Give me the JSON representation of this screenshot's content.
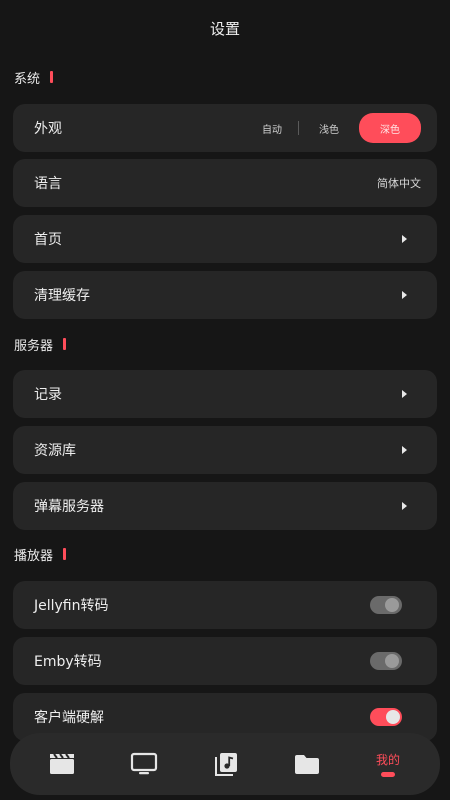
{
  "header": {
    "title": "设置"
  },
  "sections": {
    "system": {
      "title": "系统"
    },
    "server": {
      "title": "服务器"
    },
    "player": {
      "title": "播放器"
    }
  },
  "system": {
    "appearance": {
      "label": "外观",
      "options": [
        "自动",
        "浅色",
        "深色"
      ],
      "selected": "深色"
    },
    "language": {
      "label": "语言",
      "value": "简体中文"
    },
    "home": {
      "label": "首页"
    },
    "clear_cache": {
      "label": "清理缓存"
    }
  },
  "server": {
    "records": {
      "label": "记录"
    },
    "library": {
      "label": "资源库"
    },
    "danmaku": {
      "label": "弹幕服务器"
    }
  },
  "player": {
    "jellyfin": {
      "label": "Jellyfin转码",
      "enabled": false
    },
    "emby": {
      "label": "Emby转码",
      "enabled": false
    },
    "hwdecode": {
      "label": "客户端硬解",
      "enabled": true
    }
  },
  "tabbar": {
    "tabs": [
      {
        "icon": "clapperboard-icon"
      },
      {
        "icon": "tv-icon"
      },
      {
        "icon": "music-library-icon"
      },
      {
        "icon": "folder-icon"
      },
      {
        "label": "我的",
        "active": true
      }
    ]
  },
  "colors": {
    "accent": "#ff4d5a",
    "background": "#161616",
    "card": "#262626"
  }
}
